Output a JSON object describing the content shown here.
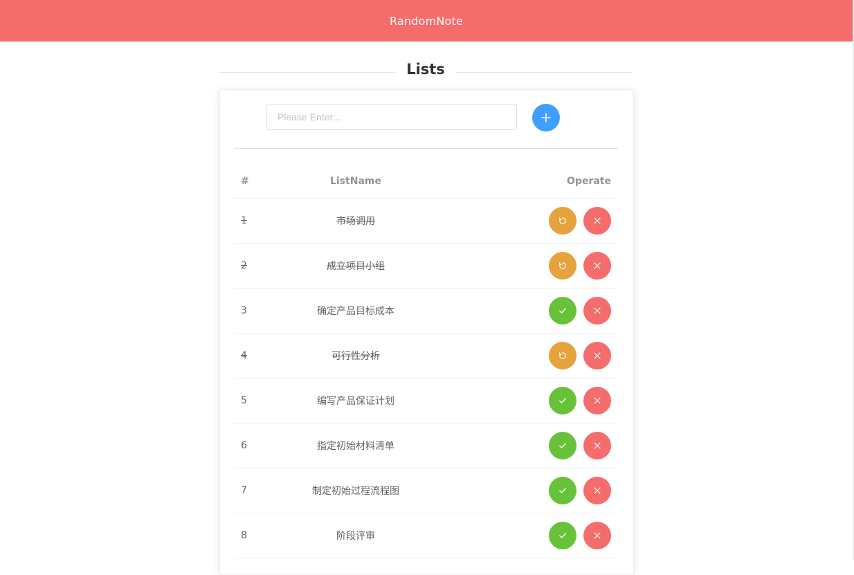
{
  "app": {
    "title": "RandomNote",
    "header_color": "#f56c6c"
  },
  "section": {
    "title": "Lists"
  },
  "add_form": {
    "placeholder": "Please Enter...",
    "value": "",
    "add_icon": "plus-icon",
    "add_button_color": "#409eff"
  },
  "table": {
    "columns": [
      "#",
      "ListName",
      "Operate"
    ],
    "rows": [
      {
        "index": "1",
        "name": "市场调用",
        "done": true
      },
      {
        "index": "2",
        "name": "成立项目小组",
        "done": true
      },
      {
        "index": "3",
        "name": "确定产品目标成本",
        "done": false
      },
      {
        "index": "4",
        "name": "可行性分析",
        "done": true
      },
      {
        "index": "5",
        "name": "编写产品保证计划",
        "done": false
      },
      {
        "index": "6",
        "name": "指定初始材料清单",
        "done": false
      },
      {
        "index": "7",
        "name": "制定初始过程流程图",
        "done": false
      },
      {
        "index": "8",
        "name": "阶段评审",
        "done": false
      }
    ]
  },
  "colors": {
    "undo": "#e6a23c",
    "complete": "#67c23a",
    "delete": "#f56c6c"
  }
}
